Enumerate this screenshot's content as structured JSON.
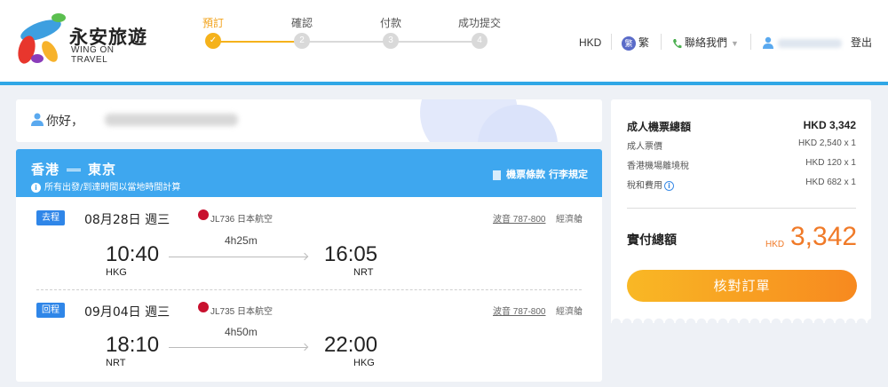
{
  "header": {
    "logo_cn": "永安旅遊",
    "logo_en": "WING ON TRAVEL",
    "steps": [
      {
        "label": "預訂",
        "marker": "✓",
        "active": true
      },
      {
        "label": "確認",
        "marker": "2",
        "active": false
      },
      {
        "label": "付款",
        "marker": "3",
        "active": false
      },
      {
        "label": "成功提交",
        "marker": "4",
        "active": false
      }
    ],
    "currency": "HKD",
    "lang_badge": "繁",
    "language": "繁",
    "contact": "聯絡我們",
    "logout": "登出"
  },
  "greeting": {
    "text": "你好，"
  },
  "flight": {
    "route_from": "香港",
    "route_to": "東京",
    "time_note": "所有出發/到達時間以當地時間計算",
    "rules_link": "機票條款 行李規定",
    "outbound": {
      "tag": "去程",
      "date": "08月28日 週三",
      "airline": "JL736 日本航空",
      "aircraft": "波音 787-800",
      "cabin": "經濟艙",
      "duration": "4h25m",
      "dep_time": "10:40",
      "dep_code": "HKG",
      "arr_time": "16:05",
      "arr_code": "NRT"
    },
    "inbound": {
      "tag": "回程",
      "date": "09月04日 週三",
      "airline": "JL735 日本航空",
      "aircraft": "波音 787-800",
      "cabin": "經濟艙",
      "duration": "4h50m",
      "dep_time": "18:10",
      "dep_code": "NRT",
      "arr_time": "22:00",
      "arr_code": "HKG"
    }
  },
  "price": {
    "total_label": "成人機票總額",
    "total_value": "HKD 3,342",
    "rows": [
      {
        "label": "成人票價",
        "value": "HKD 2,540 x 1"
      },
      {
        "label": "香港機場離境稅",
        "value": "HKD 120 x 1"
      },
      {
        "label": "稅和費用",
        "value": "HKD 682 x 1"
      }
    ],
    "pay_label": "實付總額",
    "pay_currency": "HKD",
    "pay_amount": "3,342",
    "check_button": "核對訂單"
  },
  "colors": {
    "accent": "#f5b21b",
    "header_blue": "#3ea7ef",
    "price_orange": "#f07a28"
  }
}
